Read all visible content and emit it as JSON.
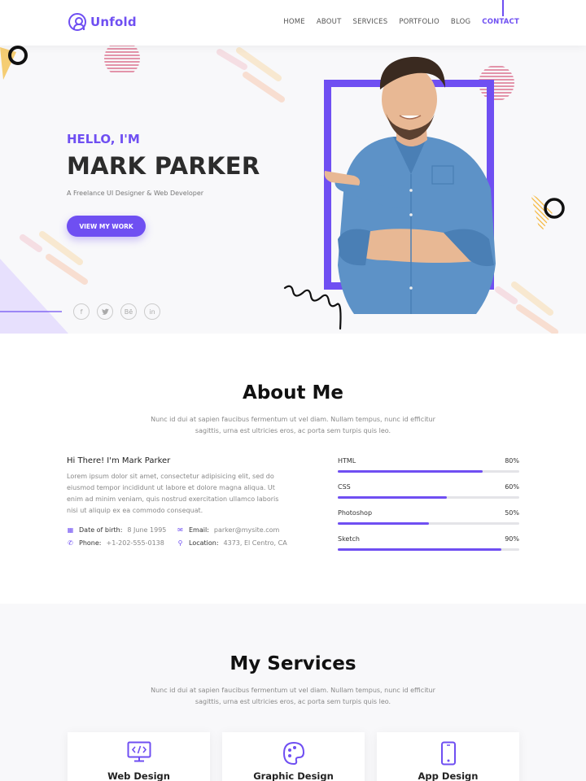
{
  "brand": {
    "name": "Unfold",
    "accent": "#6f4ff2"
  },
  "nav": {
    "items": [
      "HOME",
      "ABOUT",
      "SERVICES",
      "PORTFOLIO",
      "BLOG",
      "CONTACT"
    ],
    "active": "CONTACT"
  },
  "hero": {
    "greeting": "HELLO, I'M",
    "name": "MARK PARKER",
    "role": "A Freelance UI Designer & Web Developer",
    "cta": "VIEW MY WORK",
    "socials": [
      "facebook-icon",
      "twitter-icon",
      "behance-icon",
      "linkedin-icon"
    ]
  },
  "about": {
    "title": "About Me",
    "subtitle_line1": "Nunc id dui at sapien faucibus fermentum ut vel diam. Nullam tempus, nunc id efficitur",
    "subtitle_line2": "sagittis, urna est ultricies eros, ac porta sem turpis quis leo.",
    "heading": "Hi There! I'm Mark Parker",
    "text": "Lorem ipsum dolor sit amet, consectetur adipisicing elit, sed do eiusmod tempor incididunt ut labore et dolore magna aliqua. Ut enim ad minim veniam, quis nostrud exercitation ullamco laboris nisi ut aliquip ex ea commodo consequat.",
    "info": {
      "dob_label": "Date of birth:",
      "dob": "8 June 1995",
      "email_label": "Email:",
      "email": "parker@mysite.com",
      "phone_label": "Phone:",
      "phone": "+1-202-555-0138",
      "location_label": "Location:",
      "location": "4373, El Centro, CA"
    },
    "skills": [
      {
        "name": "HTML",
        "percent_label": "80%",
        "value": 80
      },
      {
        "name": "CSS",
        "percent_label": "60%",
        "value": 60
      },
      {
        "name": "Photoshop",
        "percent_label": "50%",
        "value": 50
      },
      {
        "name": "Sketch",
        "percent_label": "90%",
        "value": 90
      }
    ]
  },
  "services": {
    "title": "My Services",
    "subtitle_line1": "Nunc id dui at sapien faucibus fermentum ut vel diam. Nullam tempus, nunc id efficitur",
    "subtitle_line2": "sagittis, urna est ultricies eros, ac porta sem turpis quis leo.",
    "cards": [
      {
        "title": "Web Design",
        "icon": "monitor-code-icon"
      },
      {
        "title": "Graphic Design",
        "icon": "palette-icon"
      },
      {
        "title": "App Design",
        "icon": "smartphone-icon"
      }
    ]
  }
}
